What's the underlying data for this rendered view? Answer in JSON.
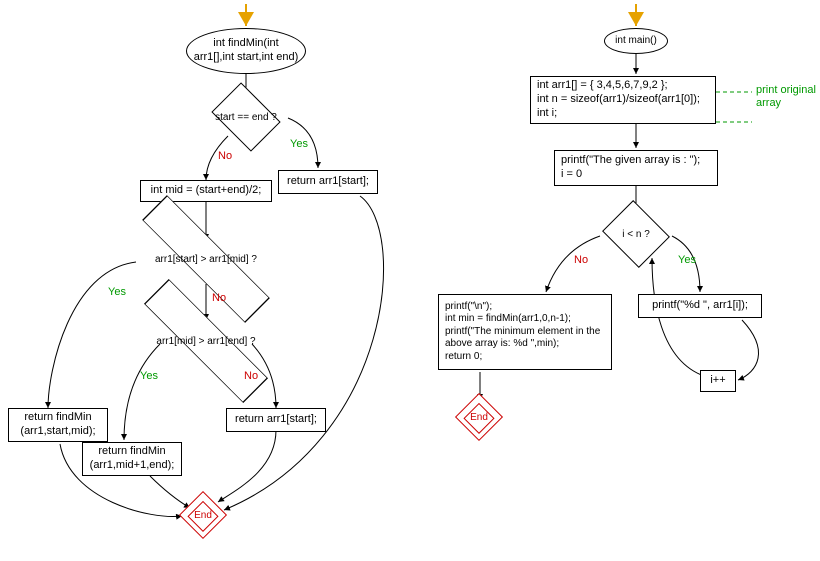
{
  "chart_data": [
    {
      "type": "flowchart",
      "name": "findMin",
      "nodes": {
        "start": {
          "shape": "ellipse",
          "text": "int findMin(int arr1[],int start,int end)"
        },
        "d1": {
          "shape": "decision",
          "text": "start == end ?"
        },
        "retStart1": {
          "shape": "rect",
          "text": "return arr1[start];"
        },
        "mid": {
          "shape": "rect",
          "text": "int mid = (start+end)/2;"
        },
        "d2": {
          "shape": "decision",
          "text": "arr1[start] > arr1[mid] ?"
        },
        "recLeft": {
          "shape": "rect",
          "text": "return findMin (arr1,start,mid);"
        },
        "d3": {
          "shape": "decision",
          "text": "arr1[mid] > arr1[end] ?"
        },
        "recRight": {
          "shape": "rect",
          "text": "return findMin (arr1,mid+1,end);"
        },
        "retStart2": {
          "shape": "rect",
          "text": "return arr1[start];"
        },
        "end": {
          "shape": "end",
          "text": "End"
        }
      },
      "edges": [
        {
          "from": "start",
          "to": "d1"
        },
        {
          "from": "d1",
          "to": "retStart1",
          "label": "Yes"
        },
        {
          "from": "d1",
          "to": "mid",
          "label": "No"
        },
        {
          "from": "mid",
          "to": "d2"
        },
        {
          "from": "d2",
          "to": "recLeft",
          "label": "Yes"
        },
        {
          "from": "d2",
          "to": "d3",
          "label": "No"
        },
        {
          "from": "d3",
          "to": "recRight",
          "label": "Yes"
        },
        {
          "from": "d3",
          "to": "retStart2",
          "label": "No"
        },
        {
          "from": "retStart1",
          "to": "end"
        },
        {
          "from": "recLeft",
          "to": "end"
        },
        {
          "from": "recRight",
          "to": "end"
        },
        {
          "from": "retStart2",
          "to": "end"
        }
      ]
    },
    {
      "type": "flowchart",
      "name": "main",
      "nodes": {
        "start": {
          "shape": "ellipse",
          "text": "int main()"
        },
        "decls": {
          "shape": "rect",
          "text": "int arr1[] = { 3,4,5,6,7,9,2 };\nint n = sizeof(arr1)/sizeof(arr1[0]);\nint i;"
        },
        "init": {
          "shape": "rect",
          "text": "printf(\"The given array is :  \");\ni = 0"
        },
        "cond": {
          "shape": "decision",
          "text": "i < n ?"
        },
        "body": {
          "shape": "rect",
          "text": "printf(\"%d  \", arr1[i]);"
        },
        "inc": {
          "shape": "rect",
          "text": "i++"
        },
        "after": {
          "shape": "rect",
          "text": "printf(\"\\n\");\nint min = findMin(arr1,0,n-1);\nprintf(\"The minimum element in the above array is: %d \",min);\nreturn 0;"
        },
        "end": {
          "shape": "end",
          "text": "End"
        }
      },
      "edges": [
        {
          "from": "start",
          "to": "decls"
        },
        {
          "from": "decls",
          "to": "init"
        },
        {
          "from": "init",
          "to": "cond"
        },
        {
          "from": "cond",
          "to": "body",
          "label": "Yes"
        },
        {
          "from": "body",
          "to": "inc"
        },
        {
          "from": "inc",
          "to": "cond"
        },
        {
          "from": "cond",
          "to": "after",
          "label": "No"
        },
        {
          "from": "after",
          "to": "end"
        }
      ],
      "comments": [
        {
          "text": "print original array",
          "attached_to": "decls"
        }
      ]
    }
  ],
  "labels": {
    "yes": "Yes",
    "no": "No",
    "end": "End"
  }
}
